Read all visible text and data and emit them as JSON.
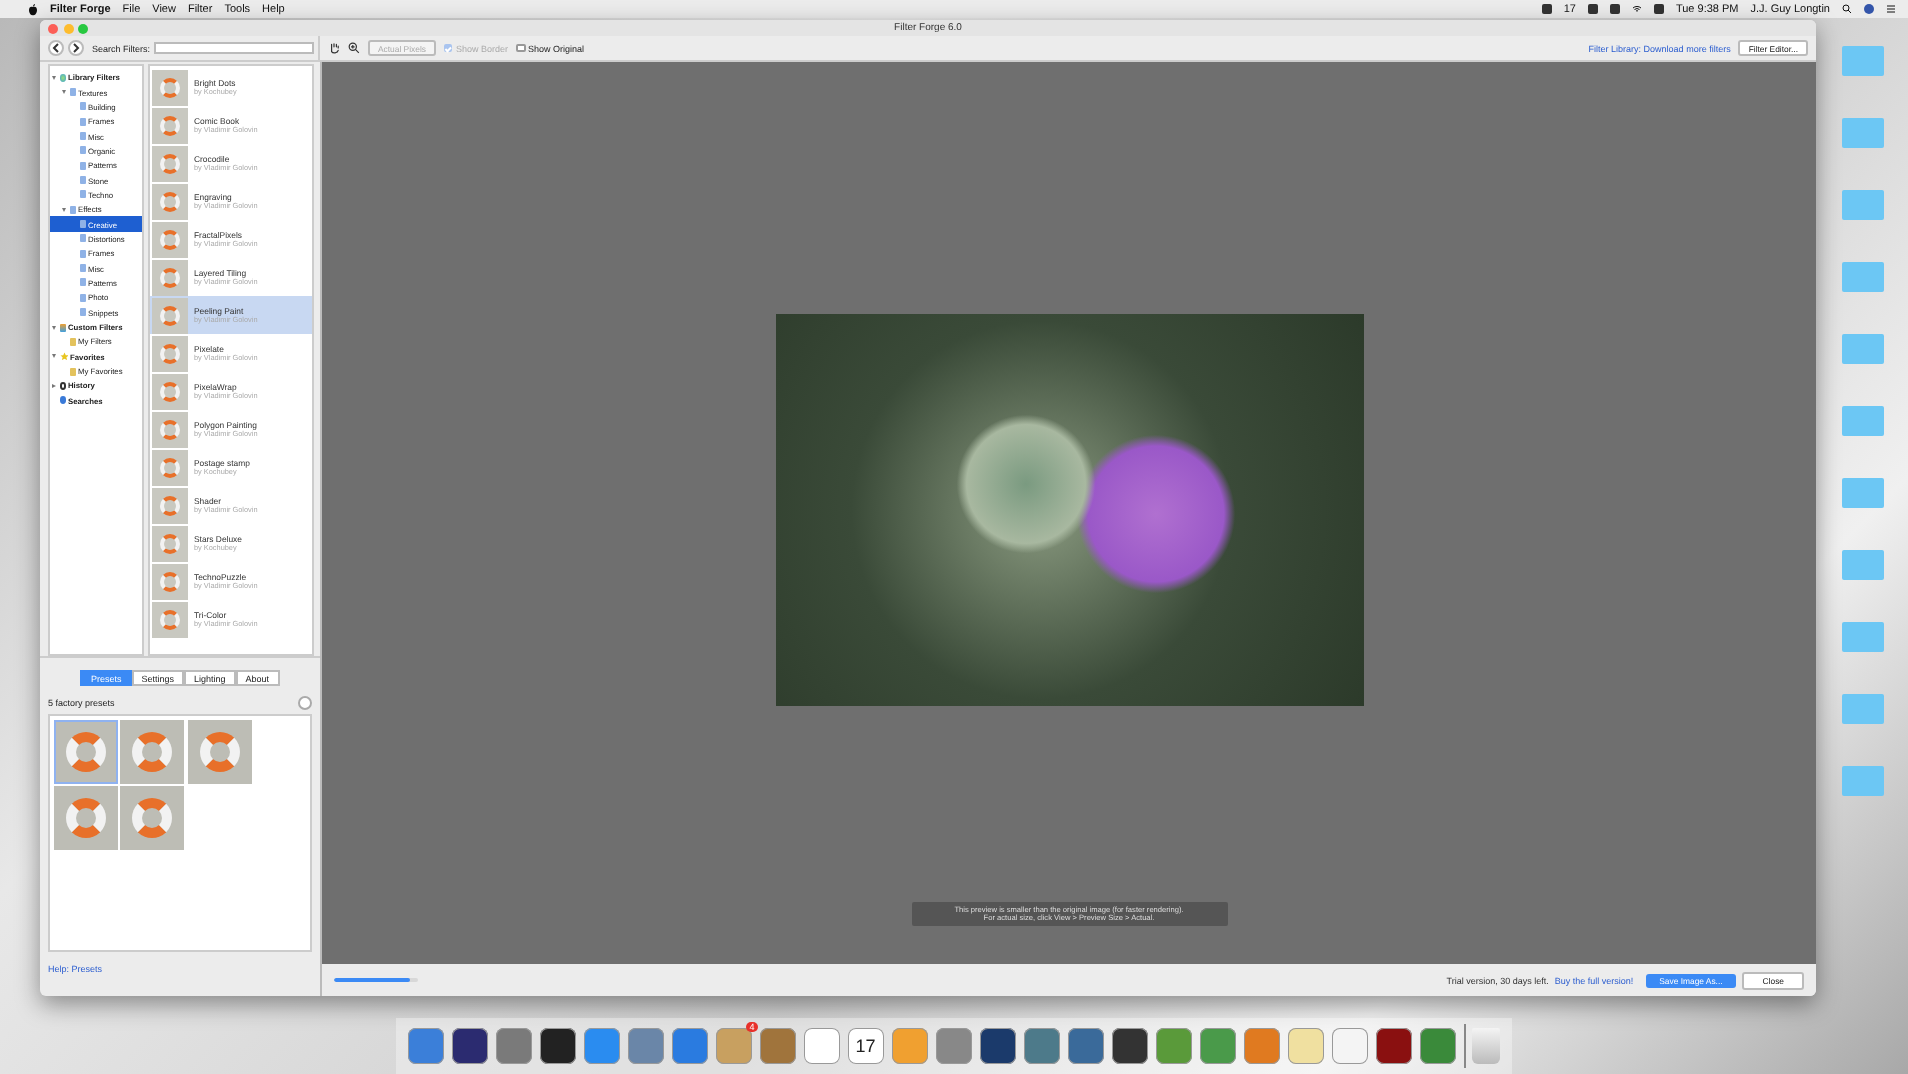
{
  "menu_bar": {
    "app_name": "Filter Forge",
    "menus": [
      "File",
      "View",
      "Filter",
      "Tools",
      "Help"
    ],
    "status_text": "17",
    "clock": "Tue 9:38 PM",
    "user": "J.J. Guy Longtin"
  },
  "window": {
    "title": "Filter Forge 6.0"
  },
  "toolbar": {
    "search_label": "Search Filters:",
    "actual_pixels": {
      "label": "Actual Pixels",
      "disabled": true
    },
    "show_border": {
      "label": "Show Border",
      "checked": true,
      "disabled": true
    },
    "show_original": {
      "label": "Show Original",
      "checked": false,
      "disabled": false
    },
    "library_link": "Filter Library: Download more filters",
    "filter_editor": "Filter Editor..."
  },
  "tree": [
    {
      "label": "Library Filters",
      "kind": "library",
      "expanded": true,
      "selected": false,
      "children": [
        {
          "label": "Textures",
          "kind": "folder",
          "expanded": true,
          "selected": false,
          "children": [
            {
              "label": "Building",
              "kind": "folder",
              "selected": false
            },
            {
              "label": "Frames",
              "kind": "folder",
              "selected": false
            },
            {
              "label": "Misc",
              "kind": "folder",
              "selected": false
            },
            {
              "label": "Organic",
              "kind": "folder",
              "selected": false
            },
            {
              "label": "Patterns",
              "kind": "folder",
              "selected": false
            },
            {
              "label": "Stone",
              "kind": "folder",
              "selected": false
            },
            {
              "label": "Techno",
              "kind": "folder",
              "selected": false
            }
          ]
        },
        {
          "label": "Effects",
          "kind": "folder",
          "expanded": true,
          "selected": false,
          "children": [
            {
              "label": "Creative",
              "kind": "folder",
              "selected": true
            },
            {
              "label": "Distortions",
              "kind": "folder",
              "selected": false
            },
            {
              "label": "Frames",
              "kind": "folder",
              "selected": false
            },
            {
              "label": "Misc",
              "kind": "folder",
              "selected": false
            },
            {
              "label": "Patterns",
              "kind": "folder",
              "selected": false
            },
            {
              "label": "Photo",
              "kind": "folder",
              "selected": false
            },
            {
              "label": "Snippets",
              "kind": "folder",
              "selected": false
            }
          ]
        }
      ]
    },
    {
      "label": "Custom Filters",
      "kind": "custom",
      "expanded": true,
      "selected": false,
      "children": [
        {
          "label": "My Filters",
          "kind": "user",
          "selected": false
        }
      ]
    },
    {
      "label": "Favorites",
      "kind": "favorites",
      "expanded": true,
      "selected": false,
      "children": [
        {
          "label": "My Favorites",
          "kind": "user",
          "selected": false
        }
      ]
    },
    {
      "label": "History",
      "kind": "history",
      "expanded": false,
      "selected": false
    },
    {
      "label": "Searches",
      "kind": "searches",
      "selected": false
    }
  ],
  "filters": [
    {
      "name": "Bright Dots",
      "author": "by Kochubey",
      "selected": false
    },
    {
      "name": "Comic Book",
      "author": "by Vladimir Golovin",
      "selected": false
    },
    {
      "name": "Crocodile",
      "author": "by Vladimir Golovin",
      "selected": false
    },
    {
      "name": "Engraving",
      "author": "by Vladimir Golovin",
      "selected": false
    },
    {
      "name": "FractalPixels",
      "author": "by Vladimir Golovin",
      "selected": false
    },
    {
      "name": "Layered Tiling",
      "author": "by Vladimir Golovin",
      "selected": false
    },
    {
      "name": "Peeling Paint",
      "author": "by Vladimir Golovin",
      "selected": true
    },
    {
      "name": "Pixelate",
      "author": "by Vladimir Golovin",
      "selected": false
    },
    {
      "name": "PixelaWrap",
      "author": "by Vladimir Golovin",
      "selected": false
    },
    {
      "name": "Polygon Painting",
      "author": "by Vladimir Golovin",
      "selected": false
    },
    {
      "name": "Postage stamp",
      "author": "by Kochubey",
      "selected": false
    },
    {
      "name": "Shader",
      "author": "by Vladimir Golovin",
      "selected": false
    },
    {
      "name": "Stars Deluxe",
      "author": "by Kochubey",
      "selected": false
    },
    {
      "name": "TechnoPuzzle",
      "author": "by Vladimir Golovin",
      "selected": false
    },
    {
      "name": "Tri-Color",
      "author": "by Vladimir Golovin",
      "selected": false
    }
  ],
  "presets_panel": {
    "tabs": [
      {
        "label": "Presets",
        "selected": true
      },
      {
        "label": "Settings",
        "selected": false
      },
      {
        "label": "Lighting",
        "selected": false
      },
      {
        "label": "About",
        "selected": false
      }
    ],
    "count": "5 factory presets",
    "presets": [
      {
        "selected": true
      },
      {
        "selected": false
      },
      {
        "selected": false
      },
      {
        "selected": false
      },
      {
        "selected": false
      }
    ],
    "help_link": "Help: Presets"
  },
  "preview": {
    "notice": "This preview is smaller than the original image (for faster rendering).\nFor actual size, click View > Preview Size > Actual."
  },
  "status_bar": {
    "progress": {
      "level": 0.9
    },
    "trial_text": "Trial version, 30 days left.",
    "buy_link": "Buy the full version!",
    "save_button": "Save Image As...",
    "close_button": "Close"
  },
  "dock": {
    "calendar_day": "17",
    "mail_badge": "4"
  }
}
